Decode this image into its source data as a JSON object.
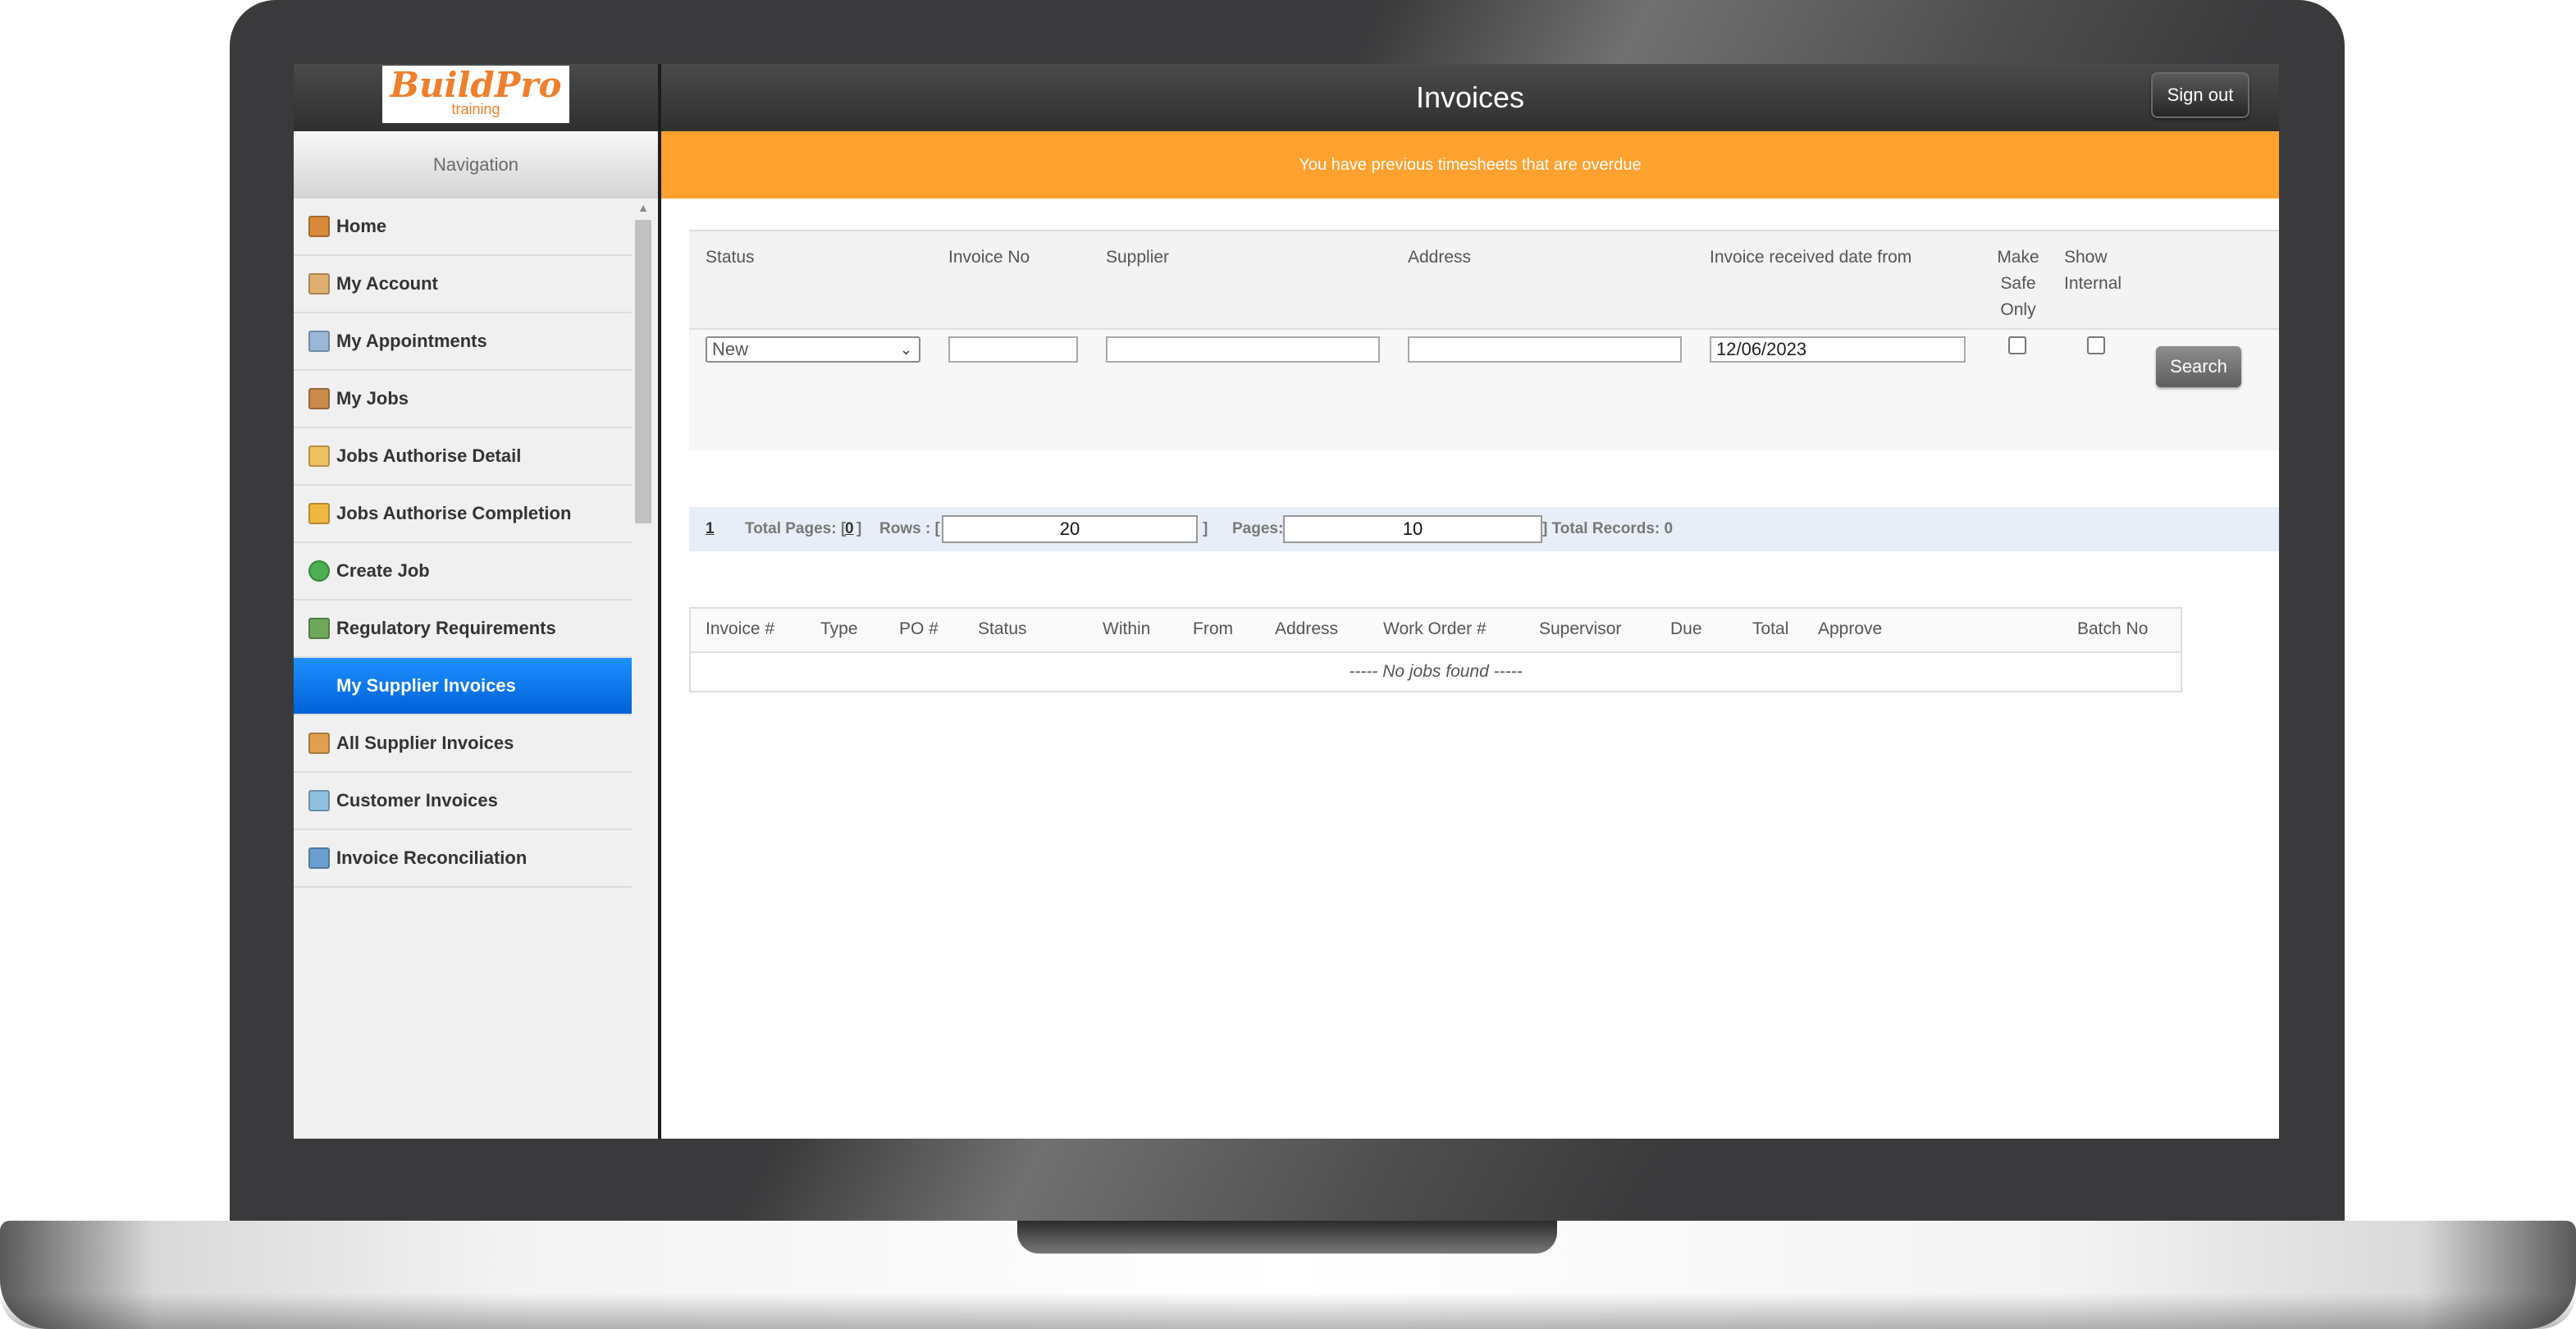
{
  "app": {
    "logo_text": "BuildPro",
    "logo_subtext": "training",
    "page_title": "Invoices",
    "signout_label": "Sign out"
  },
  "sidebar": {
    "header": "Navigation",
    "items": [
      {
        "label": "Home",
        "icon": "house-icon"
      },
      {
        "label": "My Account",
        "icon": "user-key-icon"
      },
      {
        "label": "My Appointments",
        "icon": "calendar-icon"
      },
      {
        "label": "My Jobs",
        "icon": "worker-icon"
      },
      {
        "label": "Jobs Authorise Detail",
        "icon": "folder-check-icon"
      },
      {
        "label": "Jobs Authorise Completion",
        "icon": "folder-pencil-icon"
      },
      {
        "label": "Create Job",
        "icon": "add-circle-icon"
      },
      {
        "label": "Regulatory Requirements",
        "icon": "truck-icon"
      },
      {
        "label": "My Supplier Invoices",
        "icon": "",
        "active": true
      },
      {
        "label": "All Supplier Invoices",
        "icon": "invoices-icon"
      },
      {
        "label": "Customer Invoices",
        "icon": "document-icon"
      },
      {
        "label": "Invoice Reconciliation",
        "icon": "ledger-icon"
      }
    ]
  },
  "alert": {
    "text": "You have previous timesheets that are overdue",
    "color": "#ffa12f"
  },
  "filters": {
    "labels": {
      "status": "Status",
      "invoice_no": "Invoice No",
      "supplier": "Supplier",
      "address": "Address",
      "received_from": "Invoice received date from",
      "make_safe_only": "Make Safe Only",
      "show_internal": "Show Internal"
    },
    "values": {
      "status": "New",
      "invoice_no": "",
      "supplier": "",
      "address": "",
      "received_from": "12/06/2023",
      "make_safe_only": false,
      "show_internal": false
    },
    "search_label": "Search"
  },
  "pager": {
    "current_page": "1",
    "total_pages_label": "Total Pages: [",
    "total_pages": "0",
    "rows_label": "Rows : [",
    "rows_value": "20",
    "pages_label": "Pages: [",
    "pages_value": "10",
    "total_records_label": "] Total Records: 0"
  },
  "results": {
    "columns": [
      "Invoice #",
      "Type",
      "PO #",
      "Status",
      "Within",
      "From",
      "Address",
      "Work Order #",
      "Supervisor",
      "Due",
      "Total",
      "Approve",
      "Batch No"
    ],
    "empty_text": "----- No jobs found -----"
  },
  "colors": {
    "active_nav": "#0061d8",
    "logo_orange": "#ef7f2a",
    "header_dark": "#2f2f2f"
  }
}
